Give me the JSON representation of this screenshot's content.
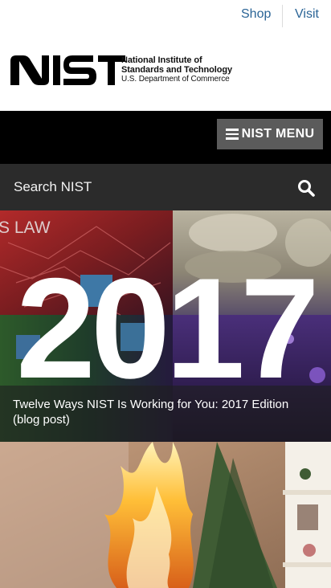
{
  "utility_nav": {
    "shop": "Shop",
    "visit": "Visit"
  },
  "logo": {
    "wordmark": "NIST",
    "line1": "National Institute of",
    "line2": "Standards and Technology",
    "line3": "U.S. Department of Commerce"
  },
  "menu": {
    "label": "NIST MENU"
  },
  "search": {
    "placeholder": "Search NIST"
  },
  "features": [
    {
      "background_text": "S LAW",
      "title": "2017",
      "caption": "Twelve Ways NIST Is Working for You: 2017 Edition (blog post)"
    },
    {
      "caption": ""
    }
  ],
  "colors": {
    "link": "#2a6496",
    "menu_bg": "#000000",
    "menu_button": "#5b5b5b",
    "search_bg": "#2b2b2b"
  }
}
